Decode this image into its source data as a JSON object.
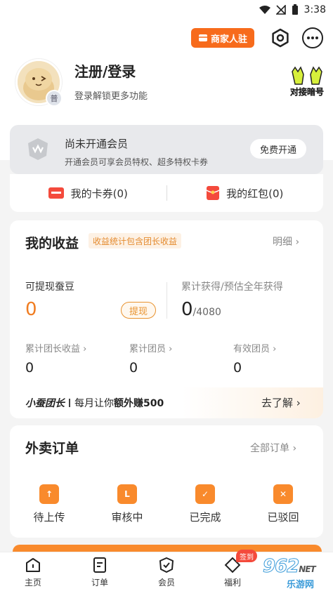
{
  "status_bar": {
    "time": "3:38"
  },
  "header": {
    "merchant_label": "商家人驻"
  },
  "profile": {
    "login_title": "注册/登录",
    "login_subtitle": "登录解锁更多功能",
    "level_badge": "普",
    "promo_label": "对接暗号"
  },
  "vip": {
    "title": "尚未开通会员",
    "subtitle": "开通会员可享会员特权、超多特权卡券",
    "button": "免费开通"
  },
  "wallet": {
    "coupons_label": "我的卡券(0)",
    "redpacket_label": "我的红包(0)"
  },
  "income": {
    "title": "我的收益",
    "tag": "收益统计包含团长收益",
    "detail_link": "明细",
    "withdrawable_label": "可提现蚕豆",
    "withdrawable_value": "0",
    "withdraw_button": "提现",
    "cumulative_label": "累计获得/预估全年获得",
    "cumulative_value": "0",
    "cumulative_total": "/4080",
    "stats": [
      {
        "label": "累计团长收益",
        "value": "0"
      },
      {
        "label": "累计团员",
        "value": "0"
      },
      {
        "label": "有效团员",
        "value": "0"
      }
    ],
    "leader_brand": "小蚕团长",
    "leader_text_prefix": "每月让你",
    "leader_text_bold": "额外赚500",
    "leader_link": "去了解"
  },
  "orders": {
    "title": "外卖订单",
    "all_link": "全部订单",
    "items": [
      {
        "label": "待上传",
        "glyph": "↑"
      },
      {
        "label": "审核中",
        "glyph": "L"
      },
      {
        "label": "已完成",
        "glyph": "✓"
      },
      {
        "label": "已驳回",
        "glyph": "✕"
      }
    ]
  },
  "tabbar": {
    "items": [
      {
        "label": "主页"
      },
      {
        "label": "订单"
      },
      {
        "label": "会员"
      },
      {
        "label": "福利"
      }
    ],
    "sign_badge": "签到"
  },
  "watermark": {
    "text": "962",
    "sub": "乐游网",
    "net": "NET"
  },
  "colors": {
    "accent": "#f76b1c",
    "orange": "#f98a2c",
    "income_tag": "#e48a2e"
  }
}
